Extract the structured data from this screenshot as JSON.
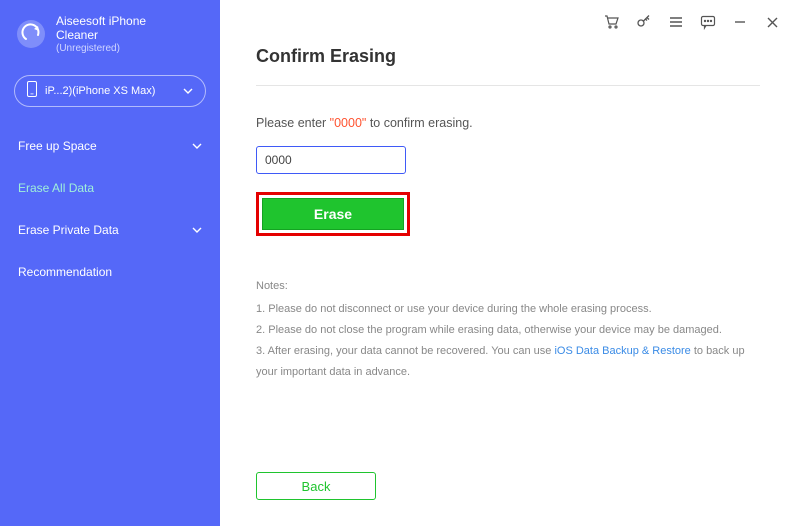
{
  "brand": {
    "title": "Aiseesoft iPhone",
    "subtitle": "Cleaner",
    "status": "(Unregistered)"
  },
  "device": {
    "label": "iP...2)(iPhone XS Max)"
  },
  "nav": {
    "freeup": "Free up Space",
    "eraseall": "Erase All Data",
    "eraseprivate": "Erase Private Data",
    "recommendation": "Recommendation"
  },
  "main": {
    "heading": "Confirm Erasing",
    "instruction_pre": "Please enter ",
    "instruction_code": "\"0000\"",
    "instruction_post": " to confirm erasing.",
    "input_value": "0000",
    "erase_label": "Erase",
    "back_label": "Back"
  },
  "notes": {
    "title": "Notes:",
    "n1": "1. Please do not disconnect or use your device during the whole erasing process.",
    "n2": "2. Please do not close the program while erasing data, otherwise your device may be damaged.",
    "n3_pre": "3. After erasing, your data cannot be recovered. You can use ",
    "n3_link": "iOS Data Backup & Restore",
    "n3_post": " to back up your important data in advance."
  }
}
